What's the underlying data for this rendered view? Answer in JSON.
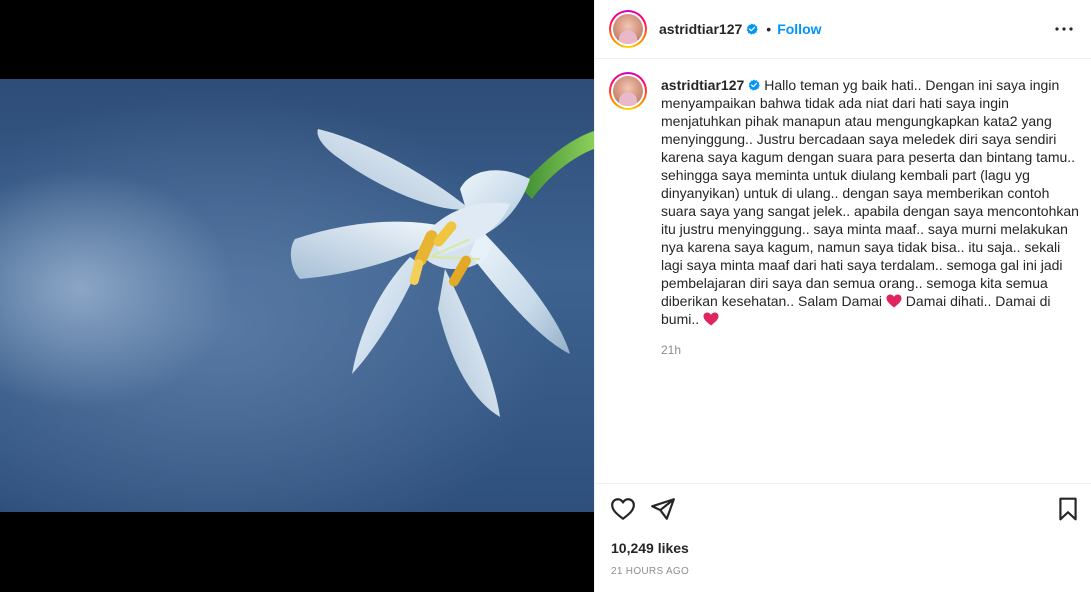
{
  "post": {
    "username": "astridtiar127",
    "follow_label": "Follow",
    "separator": "•",
    "caption": "Hallo teman yg baik hati.. Dengan ini saya ingin menyampaikan bahwa tidak ada niat dari hati saya ingin menjatuhkan pihak manapun atau mengungkapkan kata2 yang menyinggung.. Justru bercadaan saya meledek diri saya sendiri karena saya kagum dengan suara para peserta dan bintang tamu.. sehingga saya meminta untuk diulang kembali part (lagu yg dinyanyikan) untuk di ulang.. dengan saya memberikan contoh suara saya yang sangat jelek.. apabila dengan saya mencontohkan itu justru menyinggung.. saya minta maaf.. saya murni melakukan nya karena saya kagum, namun saya tidak bisa.. itu saja.. sekali lagi saya minta maaf dari hati saya terdalam.. semoga gal ini jadi pembelajaran diri saya dan semua orang.. semoga kita semua diberikan kesehatan.. Salam Damai",
    "caption_mid": " Damai dihati.. Damai di bumi.. ",
    "caption_time": "21h",
    "likes": "10,249 likes",
    "posted_ago": "21 HOURS AGO"
  },
  "colors": {
    "accent": "#0095f6",
    "text": "#262626",
    "muted": "#8e8e8e",
    "heart": "#e0245e"
  },
  "icons": [
    "verified-badge-icon",
    "more-options-icon",
    "heart-icon",
    "share-icon",
    "bookmark-icon",
    "heart-emoji-icon"
  ]
}
